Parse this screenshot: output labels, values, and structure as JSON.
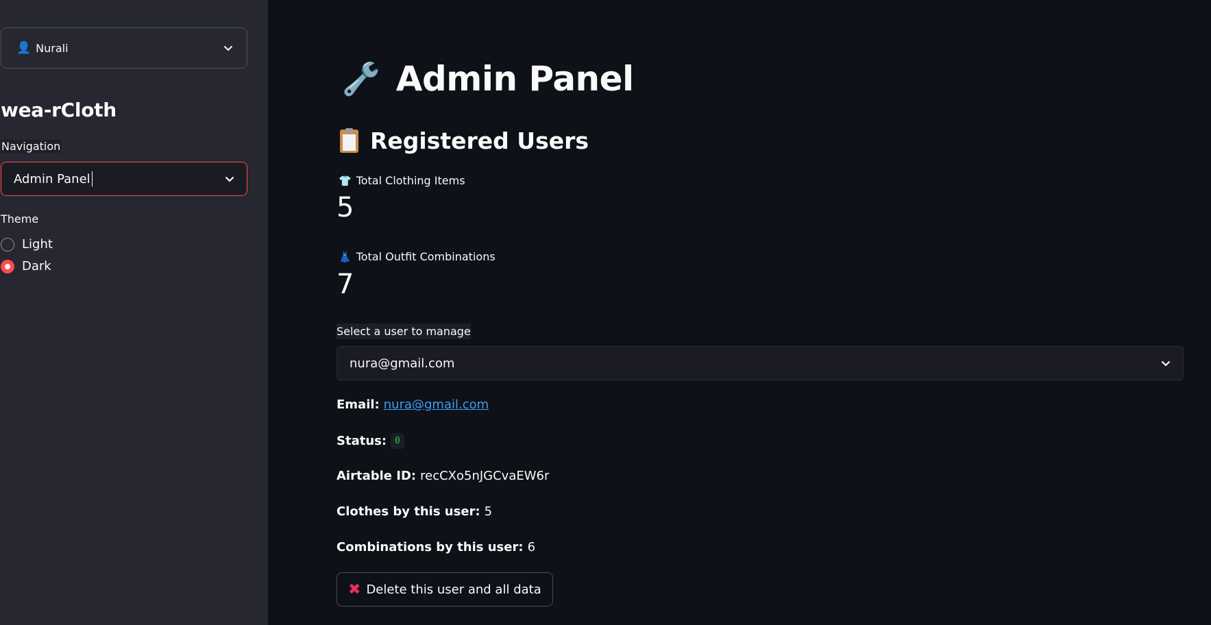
{
  "sidebar": {
    "user_menu": {
      "icon": "user-icon",
      "name": "Nurali"
    },
    "app_title": "wea-rCloth",
    "navigation": {
      "label": "Navigation",
      "selected": "Admin Panel"
    },
    "theme": {
      "label": "Theme",
      "options": [
        {
          "label": "Light",
          "checked": false
        },
        {
          "label": "Dark",
          "checked": true
        }
      ]
    }
  },
  "main": {
    "title": "Admin Panel",
    "title_icon": "wrench-icon",
    "section_title": "Registered Users",
    "section_icon": "clipboard-icon",
    "metrics": {
      "clothing": {
        "icon": "shirt-icon",
        "label": "Total Clothing Items",
        "value": "5"
      },
      "outfits": {
        "icon": "dress-icon",
        "label": "Total Outfit Combinations",
        "value": "7"
      }
    },
    "user_select": {
      "label": "Select a user to manage",
      "value": "nura@gmail.com"
    },
    "details": {
      "email_label": "Email:",
      "email": "nura@gmail.com",
      "status_label": "Status:",
      "status": "0",
      "airtable_label": "Airtable ID:",
      "airtable": "recCXo5nJGCvaEW6r",
      "clothes_label": "Clothes by this user:",
      "clothes": "5",
      "combos_label": "Combinations by this user:",
      "combos": "6"
    },
    "delete_button": {
      "icon": "cross-mark-icon",
      "label": "Delete this user and all data"
    }
  },
  "colors": {
    "sidebar_bg": "#262730",
    "main_bg": "#0e1117",
    "accent": "#ff4b4b",
    "link": "#3d9df3",
    "status_code": "#21c354"
  }
}
